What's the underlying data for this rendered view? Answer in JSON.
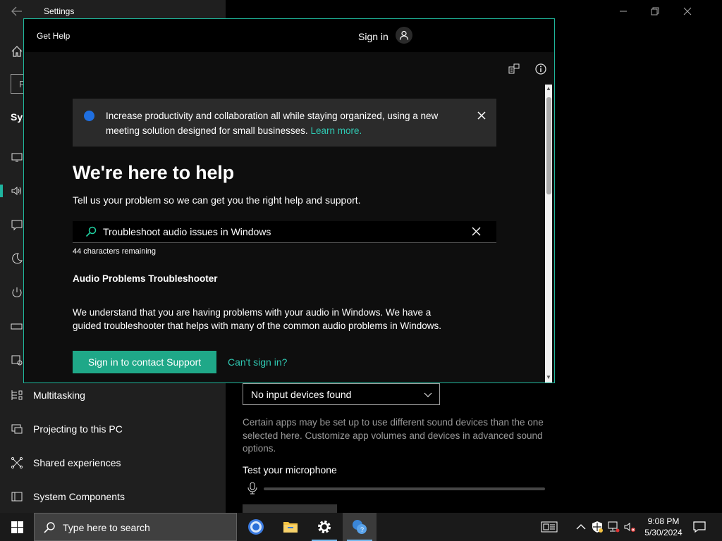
{
  "settings": {
    "title": "Settings",
    "search_stub": "F",
    "section_stub": "Sys",
    "nav_items": [
      {
        "label": "Multitasking",
        "icon": "multitasking-icon"
      },
      {
        "label": "Projecting to this PC",
        "icon": "projecting-icon"
      },
      {
        "label": "Shared experiences",
        "icon": "shared-experiences-icon"
      },
      {
        "label": "System Components",
        "icon": "system-components-icon"
      }
    ],
    "input_device": "No input devices found",
    "sound_description": "Certain apps may be set up to use different sound devices than the one selected here. Customize app volumes and devices in advanced sound options.",
    "test_mic_label": "Test your microphone",
    "accent_color": "#1fb5a0"
  },
  "get_help": {
    "title": "Get Help",
    "sign_in": "Sign in",
    "banner": {
      "text": "Increase productivity and collaboration all while staying organized, using a new meeting solution designed for small businesses.",
      "link": "Learn more."
    },
    "heading": "We're here to help",
    "subheading": "Tell us your problem so we can get you the right help and support.",
    "search_value": "Troubleshoot audio issues in Windows",
    "chars_remaining": "44 characters remaining",
    "result_title": "Audio Problems Troubleshooter",
    "result_body": "We understand that you are having problems with your audio in Windows. We have a guided troubleshooter that helps with many of the common audio problems in Windows.",
    "contact_button": "Sign in to contact Support",
    "cant_sign_in": "Can't sign in?",
    "accent_color": "#1fa888"
  },
  "taskbar": {
    "search_placeholder": "Type here to search",
    "apps": [
      "chrome-icon",
      "file-explorer-icon",
      "settings-gear-icon",
      "get-help-icon"
    ],
    "time": "9:08 PM",
    "date": "5/30/2024"
  }
}
